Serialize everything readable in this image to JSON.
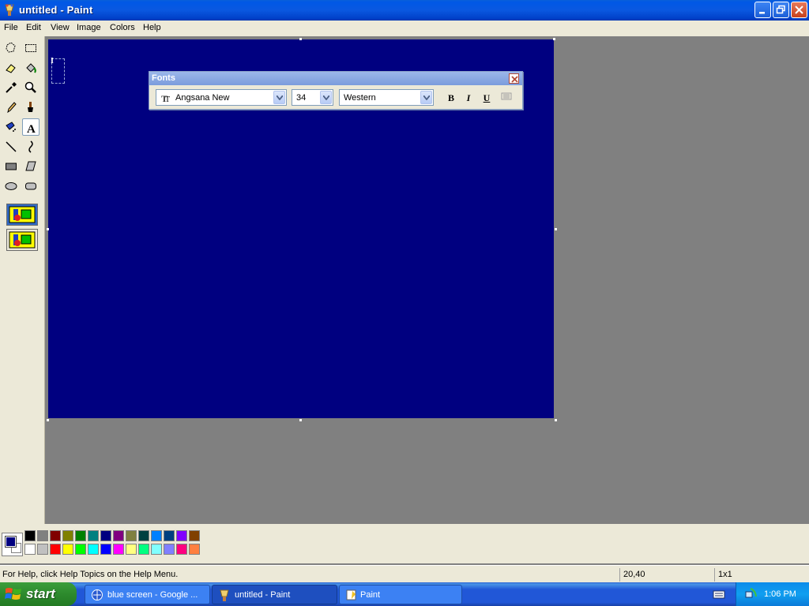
{
  "window": {
    "title": "untitled - Paint"
  },
  "menu": [
    "File",
    "Edit",
    "View",
    "Image",
    "Colors",
    "Help"
  ],
  "tools": [
    "free-form-select",
    "select",
    "eraser",
    "fill-with-color",
    "pick-color",
    "magnifier",
    "pencil",
    "brush",
    "airbrush",
    "text",
    "line",
    "curve",
    "rectangle",
    "polygon",
    "ellipse",
    "rounded-rectangle"
  ],
  "canvas": {
    "background": "#000080"
  },
  "fonts_toolbar": {
    "title": "Fonts",
    "font_name": "Angsana New",
    "font_size": "34",
    "script": "Western",
    "bold_label": "B",
    "italic_label": "I",
    "underline_label": "U"
  },
  "palette": {
    "foreground": "#000080",
    "background": "#ffffff",
    "row1": [
      "#000000",
      "#808080",
      "#800000",
      "#808000",
      "#008000",
      "#008080",
      "#000080",
      "#800080",
      "#808040",
      "#004040",
      "#0080ff",
      "#004080",
      "#8000ff",
      "#804000"
    ],
    "row2": [
      "#ffffff",
      "#c0c0c0",
      "#ff0000",
      "#ffff00",
      "#00ff00",
      "#00ffff",
      "#0000ff",
      "#ff00ff",
      "#ffff80",
      "#00ff80",
      "#80ffff",
      "#8080ff",
      "#ff0080",
      "#ff8040"
    ]
  },
  "status": {
    "help_text": "For Help, click Help Topics on the Help Menu.",
    "coordinates": "20,40",
    "selection_size": "1x1"
  },
  "taskbar": {
    "start_label": "start",
    "tasks": [
      {
        "label": "blue screen - Google ..."
      },
      {
        "label": "untitled - Paint"
      },
      {
        "label": "Paint"
      }
    ],
    "clock": "1:06 PM"
  }
}
